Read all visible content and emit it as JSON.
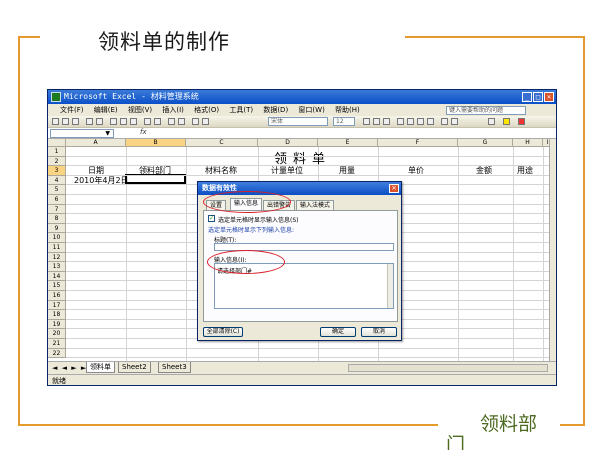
{
  "slide": {
    "title": "领料单的制作",
    "footer_line1": "领料部",
    "footer_line2": "门"
  },
  "excel": {
    "window_title": "Microsoft Excel - 材料管理系统",
    "menu": [
      "文件(F)",
      "编辑(E)",
      "视图(V)",
      "插入(I)",
      "格式(O)",
      "工具(T)",
      "数据(D)",
      "窗口(W)",
      "帮助(H)"
    ],
    "help_placeholder": "键入需要帮助的问题",
    "font_name": "宋体",
    "font_size": "12",
    "name_box": "▼",
    "fx": "fx",
    "columns": [
      "A",
      "B",
      "C",
      "D",
      "E",
      "F",
      "G",
      "H",
      "I"
    ],
    "rows": [
      "1",
      "2",
      "3",
      "4",
      "5",
      "6",
      "7",
      "8",
      "9",
      "10",
      "11",
      "12",
      "13",
      "14",
      "15",
      "16",
      "17",
      "18",
      "19",
      "20",
      "21",
      "22"
    ],
    "sheet_title": "领料单",
    "headers": [
      "日期",
      "领料部门",
      "材料名称",
      "计量单位",
      "用量",
      "单价",
      "金额",
      "用途"
    ],
    "a3": "2010年4月2日",
    "tabs": [
      "领料单",
      "Sheet2",
      "Sheet3"
    ],
    "tab_nav": "◄ ◄ ► ►",
    "status": "就绪"
  },
  "dialog": {
    "title": "数据有效性",
    "tabs": [
      "设置",
      "输入信息",
      "出错警告",
      "输入法模式"
    ],
    "checkbox_label": "选定单元格时显示输入信息(S)",
    "checkbox_checked": true,
    "hint": "选定单元格时显示下列输入信息:",
    "title_label": "标题(T):",
    "title_value": "",
    "message_label": "输入信息(I):",
    "message_value": "请选择部门#",
    "clear_all": "全部清除(C)",
    "ok": "确定",
    "cancel": "取消"
  },
  "colors": {
    "frame": "#e79a2c",
    "footer_text": "#4d6b22",
    "annotation": "#d9202a",
    "titlebar": "#0a4fc8"
  }
}
